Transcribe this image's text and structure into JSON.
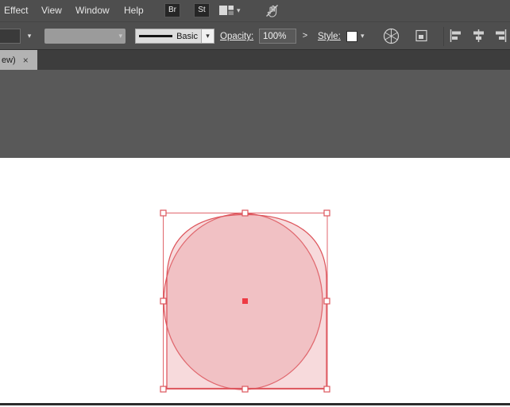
{
  "menu": {
    "items": [
      "Effect",
      "View",
      "Window",
      "Help"
    ],
    "brushes_label": "Br",
    "graphic_styles_label": "St"
  },
  "control_bar": {
    "stroke_style_value": "Basic",
    "opacity_label": "Opacity:",
    "opacity_value": "100%",
    "opacity_more_glyph": ">",
    "style_label": "Style:"
  },
  "tabbar": {
    "document_tab_label": "ew)",
    "close_glyph": "×"
  },
  "glyphs": {
    "chevron_down": "▾"
  },
  "icons": {
    "arrange_documents": "arrange-documents-icon",
    "touch_workspace": "touch-icon",
    "recolor_artwork": "recolor-artwork-icon",
    "select_similar": "select-similar-objects-icon",
    "align_left": "align-horizontal-left-icon",
    "align_center": "align-horizontal-center-icon",
    "align_right": "align-horizontal-right-icon"
  },
  "colors": {
    "selection_red": "#dd555c",
    "shape_fill_pink": "#e78f96",
    "center_point_red": "#ee3a43",
    "artboard_white": "#ffffff",
    "pasteboard_gray": "#595959"
  }
}
